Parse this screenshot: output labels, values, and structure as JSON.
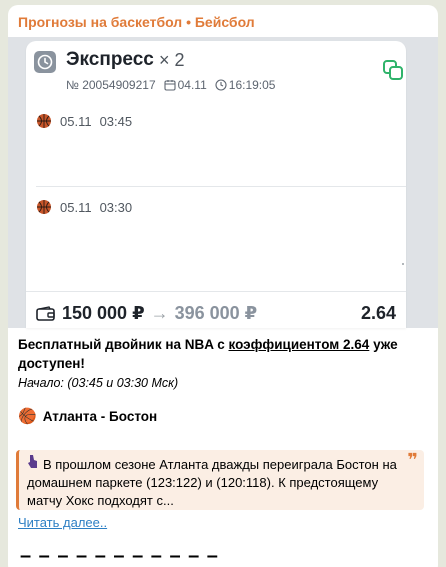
{
  "channel": {
    "name": "Прогнозы на баскетбол • Бейсбол",
    "accent": "#e07b39"
  },
  "card": {
    "title": "Экспресс",
    "multiplier": "× 2",
    "number": "№ 20054909217",
    "date": "04.11",
    "time": "16:19:05",
    "events": [
      {
        "date": "05.11",
        "time": "03:45",
        "icon": "basketball-icon"
      },
      {
        "date": "05.11",
        "time": "03:30",
        "icon": "basketball-icon"
      }
    ],
    "stake": "150 000 ₽",
    "arrow": "→",
    "payout": "396 000 ₽",
    "coefficient": "2.64"
  },
  "message": {
    "line1_pre": "Бесплатный двойник на NBA с ",
    "line1_link": "коэффициентом 2.64",
    "line1_post": " уже доступен!",
    "start": "Начало: (03:45 и 03:30 Мск)",
    "match_emoji": "🏀",
    "match": "Атланта - Бостон",
    "quote": "В прошлом сезоне Атланта дважды переиграла Бостон на домашнем паркете (123:122) и (120:118). К предстоящему матчу Хокс подходят с...",
    "quote_icon": "quote-icon",
    "read_more": "Читать далее..",
    "separator": "– – – – – – – – – – –"
  }
}
